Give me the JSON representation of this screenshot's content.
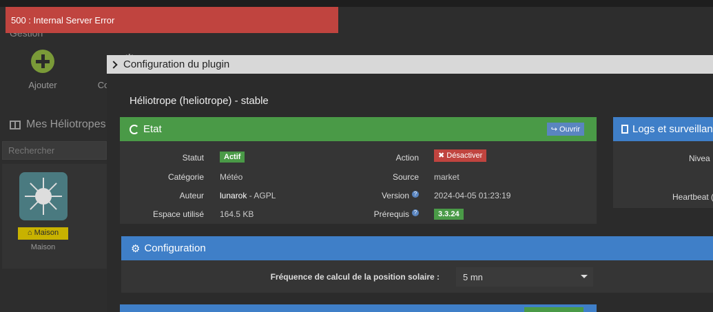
{
  "error": {
    "message": "500 : Internal Server Error"
  },
  "background": {
    "title": "Gestion",
    "actions": [
      {
        "label": "Ajouter"
      },
      {
        "label": "Co"
      }
    ],
    "list_title": "Mes Héliotropes",
    "search_placeholder": "Rechercher",
    "equipment": {
      "badge": "Maison",
      "name": "Maison"
    }
  },
  "modal": {
    "title": "Configuration du plugin",
    "plugin_title": "Héliotrope (heliotrope) - stable",
    "state": {
      "header": "Etat",
      "open_button": "Ouvrir",
      "rows": [
        {
          "label": "Statut",
          "value": "Actif"
        },
        {
          "label": "Catégorie",
          "value": "Météo"
        },
        {
          "label": "Auteur",
          "value_bold": "lunarok",
          "value": " - AGPL"
        },
        {
          "label": "Espace utilisé",
          "value": "164.5 KB"
        }
      ],
      "rows_right": [
        {
          "label": "Action",
          "value": "Désactiver"
        },
        {
          "label": "Source",
          "value": "market"
        },
        {
          "label": "Version",
          "value": "2024-04-05 01:23:19"
        },
        {
          "label": "Prérequis",
          "value": "3.3.24"
        }
      ]
    },
    "logs": {
      "header": "Logs et surveillan",
      "rows": [
        "Nivea",
        "Heartbeat ("
      ]
    },
    "configuration": {
      "header": "Configuration",
      "field_label": "Fréquence de calcul de la position solaire :",
      "field_value": "5 mn"
    }
  },
  "colors": {
    "success": "#4a9a47",
    "primary": "#3f7fc8",
    "danger": "#c0443f",
    "warning": "#c8b200"
  }
}
